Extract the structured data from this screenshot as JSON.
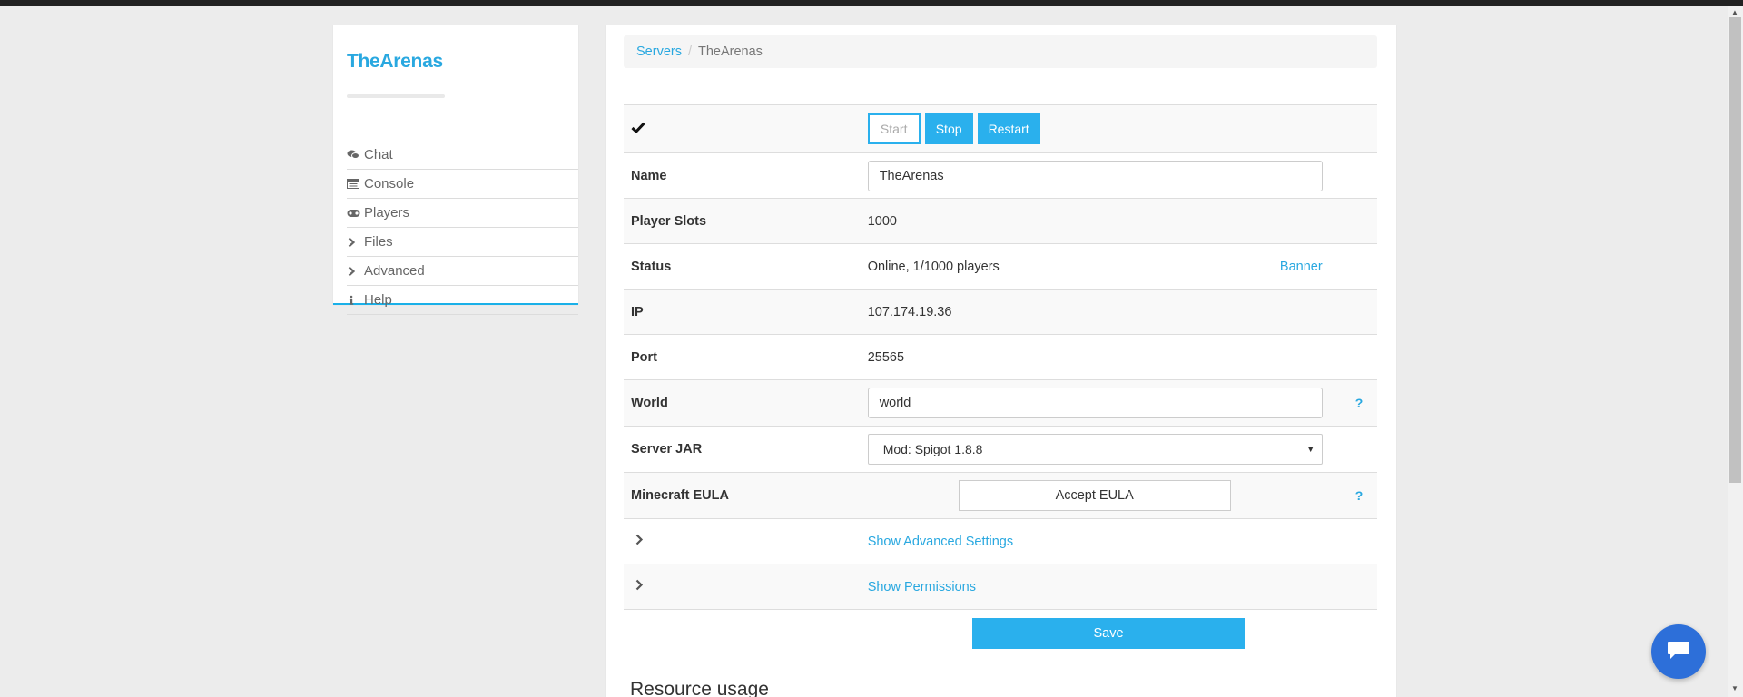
{
  "sidebar": {
    "brand": "TheArenas",
    "items": [
      {
        "label": "Chat",
        "icon": "chat-icon"
      },
      {
        "label": "Console",
        "icon": "console-icon"
      },
      {
        "label": "Players",
        "icon": "gamepad-icon"
      },
      {
        "label": "Files",
        "icon": "chevron-right-icon"
      },
      {
        "label": "Advanced",
        "icon": "chevron-right-icon"
      },
      {
        "label": "Help",
        "icon": "info-icon"
      }
    ]
  },
  "breadcrumb": {
    "root": "Servers",
    "separator": "/",
    "current": "TheArenas"
  },
  "controls": {
    "status_icon": "check-icon",
    "start_label": "Start",
    "stop_label": "Stop",
    "restart_label": "Restart"
  },
  "fields": {
    "name": {
      "label": "Name",
      "value": "TheArenas"
    },
    "player_slots": {
      "label": "Player Slots",
      "value": "1000"
    },
    "status": {
      "label": "Status",
      "value": "Online, 1/1000 players",
      "link": "Banner"
    },
    "ip": {
      "label": "IP",
      "value": "107.174.19.36"
    },
    "port": {
      "label": "Port",
      "value": "25565"
    },
    "world": {
      "label": "World",
      "value": "world",
      "help": "?"
    },
    "server_jar": {
      "label": "Server JAR",
      "value": "Mod: Spigot 1.8.8"
    },
    "eula": {
      "label": "Minecraft EULA",
      "button": "Accept EULA",
      "help": "?"
    }
  },
  "toggles": {
    "advanced": "Show Advanced Settings",
    "permissions": "Show Permissions"
  },
  "save_label": "Save",
  "resource_title": "Resource usage",
  "colors": {
    "accent": "#2ab0ed",
    "brand": "#29a8e0",
    "topbar": "#222222",
    "chat_widget": "#2d6fd9"
  }
}
